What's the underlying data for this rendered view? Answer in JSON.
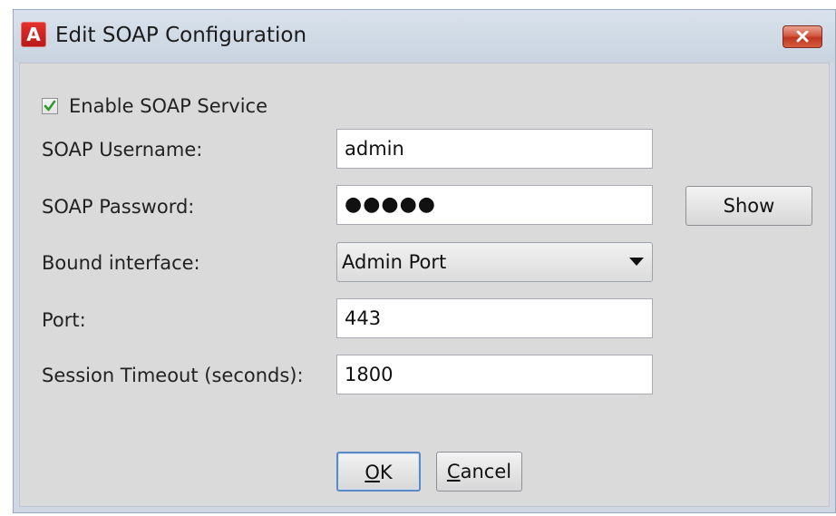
{
  "window": {
    "title": "Edit SOAP Configuration",
    "app_icon_letter": "A",
    "app_icon_color": "#d0231f"
  },
  "form": {
    "enable_soap": {
      "label": "Enable SOAP Service",
      "checked": true
    },
    "username": {
      "label": "SOAP Username:",
      "value": "admin"
    },
    "password": {
      "label": "SOAP Password:",
      "masked_value": "●●●●●",
      "show_button": "Show"
    },
    "bound_interface": {
      "label": "Bound interface:",
      "selected": "Admin Port"
    },
    "port": {
      "label": "Port:",
      "value": "443"
    },
    "session_timeout": {
      "label": "Session Timeout (seconds):",
      "value": "1800"
    }
  },
  "buttons": {
    "ok": "OK",
    "cancel": "Cancel"
  },
  "colors": {
    "content_bg": "#dadada",
    "frame_bg": "#cfd8e3",
    "close_button": "#c0351f",
    "ok_focus_border": "#5b89c8"
  },
  "icons": {
    "app": "app-logo-icon",
    "close": "close-icon",
    "check": "checkmark-icon",
    "dropdown": "chevron-down-icon"
  }
}
